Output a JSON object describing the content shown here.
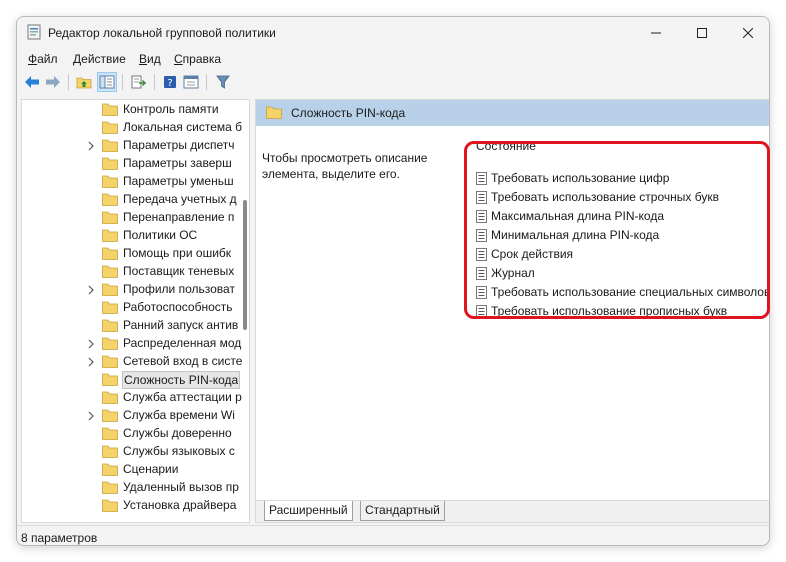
{
  "window": {
    "title": "Редактор локальной групповой политики",
    "min_icon": "minimize-icon",
    "max_icon": "maximize-icon",
    "close_icon": "close-icon"
  },
  "menu": [
    {
      "accel": "Ф",
      "rest": "айл"
    },
    {
      "accel": "Д",
      "rest": "ействие"
    },
    {
      "accel": "В",
      "rest": "ид"
    },
    {
      "accel": "С",
      "rest": "правка"
    }
  ],
  "toolbar": {
    "icons": [
      "back-icon",
      "forward-icon",
      "up-folder-icon",
      "show-hide-tree-icon",
      "export-list-icon",
      "help-icon",
      "properties-icon",
      "filter-icon"
    ]
  },
  "tree": {
    "items": [
      {
        "label": "Контроль памяти",
        "expandable": false
      },
      {
        "label": "Локальная система б",
        "expandable": false
      },
      {
        "label": "Параметры диспетч",
        "expandable": true
      },
      {
        "label": "Параметры заверш",
        "expandable": false
      },
      {
        "label": "Параметры уменьш",
        "expandable": false
      },
      {
        "label": "Передача учетных д",
        "expandable": false
      },
      {
        "label": "Перенаправление п",
        "expandable": false
      },
      {
        "label": "Политики ОС",
        "expandable": false
      },
      {
        "label": "Помощь при ошибк",
        "expandable": false
      },
      {
        "label": "Поставщик теневых",
        "expandable": false
      },
      {
        "label": "Профили пользоват",
        "expandable": true
      },
      {
        "label": "Работоспособность",
        "expandable": false
      },
      {
        "label": "Ранний запуск антив",
        "expandable": false
      },
      {
        "label": "Распределенная мод",
        "expandable": true
      },
      {
        "label": "Сетевой вход в систе",
        "expandable": true
      },
      {
        "label": "Сложность PIN-кода",
        "expandable": false,
        "selected": true
      },
      {
        "label": "Служба аттестации р",
        "expandable": false
      },
      {
        "label": "Служба времени Wi",
        "expandable": true
      },
      {
        "label": "Службы доверенно",
        "expandable": false
      },
      {
        "label": "Службы языковых с",
        "expandable": false
      },
      {
        "label": "Сценарии",
        "expandable": false
      },
      {
        "label": "Удаленный вызов пр",
        "expandable": false
      },
      {
        "label": "Установка драйвера",
        "expandable": false
      }
    ]
  },
  "right": {
    "header_title": "Сложность PIN-кода",
    "description": "Чтобы просмотреть описание элемента, выделите его.",
    "column_header": "Состояние",
    "settings": [
      "Требовать использование цифр",
      "Требовать использование строчных букв",
      "Максимальная длина PIN-кода",
      "Минимальная длина PIN-кода",
      "Срок действия",
      "Журнал",
      "Требовать использование специальных символов",
      "Требовать использование прописных букв"
    ],
    "tabs": {
      "extended": "Расширенный",
      "standard": "Стандартный"
    }
  },
  "status": {
    "text": "8 параметров"
  },
  "colors": {
    "highlight": "#e0141e",
    "header_bg": "#b9d1e8",
    "folder": "#f5d36b"
  }
}
